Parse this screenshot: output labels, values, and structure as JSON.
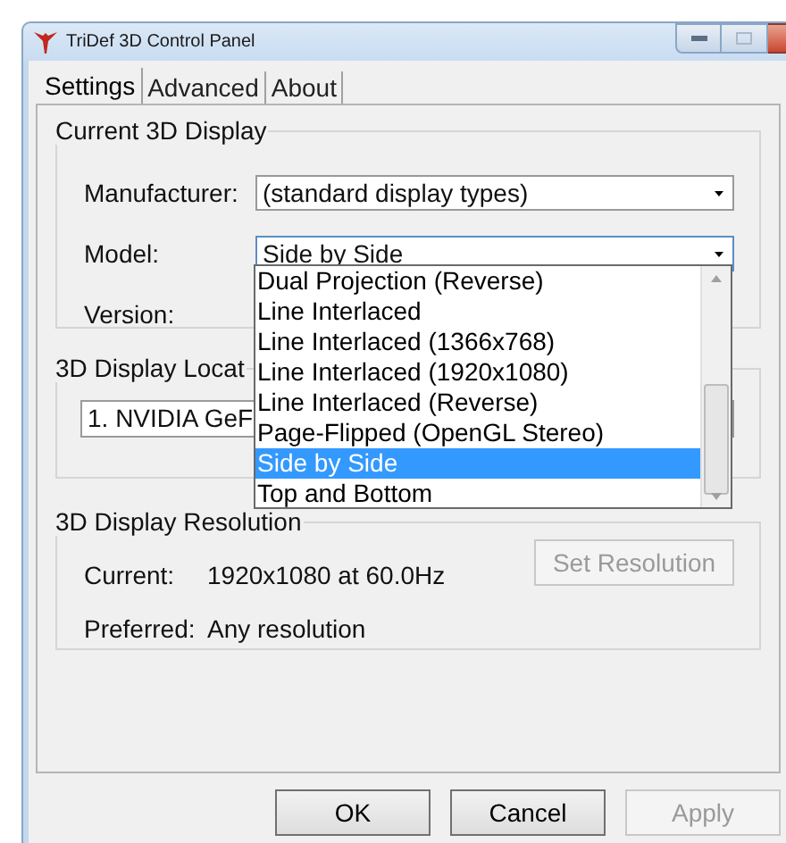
{
  "window": {
    "title": "TriDef 3D Control Panel"
  },
  "tabs": [
    {
      "label": "Settings",
      "selected": true
    },
    {
      "label": "Advanced",
      "selected": false
    },
    {
      "label": "About",
      "selected": false
    }
  ],
  "current_display": {
    "title": "Current 3D Display",
    "fields": [
      {
        "label": "Manufacturer:",
        "value": "(standard display types)",
        "expanded": false
      },
      {
        "label": "Model:",
        "value": "Side by Side",
        "expanded": true,
        "options": [
          {
            "label": "Dual Projection (Reverse)",
            "selected": false
          },
          {
            "label": "Line Interlaced",
            "selected": false
          },
          {
            "label": "Line Interlaced (1366x768)",
            "selected": false
          },
          {
            "label": "Line Interlaced (1920x1080)",
            "selected": false
          },
          {
            "label": "Line Interlaced (Reverse)",
            "selected": false
          },
          {
            "label": "Page-Flipped (OpenGL Stereo)",
            "selected": false
          },
          {
            "label": "Side by Side",
            "selected": true
          },
          {
            "label": "Top and Bottom",
            "selected": false
          }
        ]
      },
      {
        "label": "Version:"
      }
    ]
  },
  "display_location": {
    "title": "3D Display Locat",
    "value": "1. NVIDIA GeF"
  },
  "resolution": {
    "title": "3D Display Resolution",
    "current_label": "Current:",
    "current_value": "1920x1080 at 60.0Hz",
    "preferred_label": "Preferred:",
    "preferred_value": "Any resolution",
    "set_button": {
      "label": "Set Resolution",
      "disabled": true
    }
  },
  "buttons": [
    {
      "label": "OK",
      "disabled": false
    },
    {
      "label": "Cancel",
      "disabled": false
    },
    {
      "label": "Apply",
      "disabled": true
    }
  ]
}
